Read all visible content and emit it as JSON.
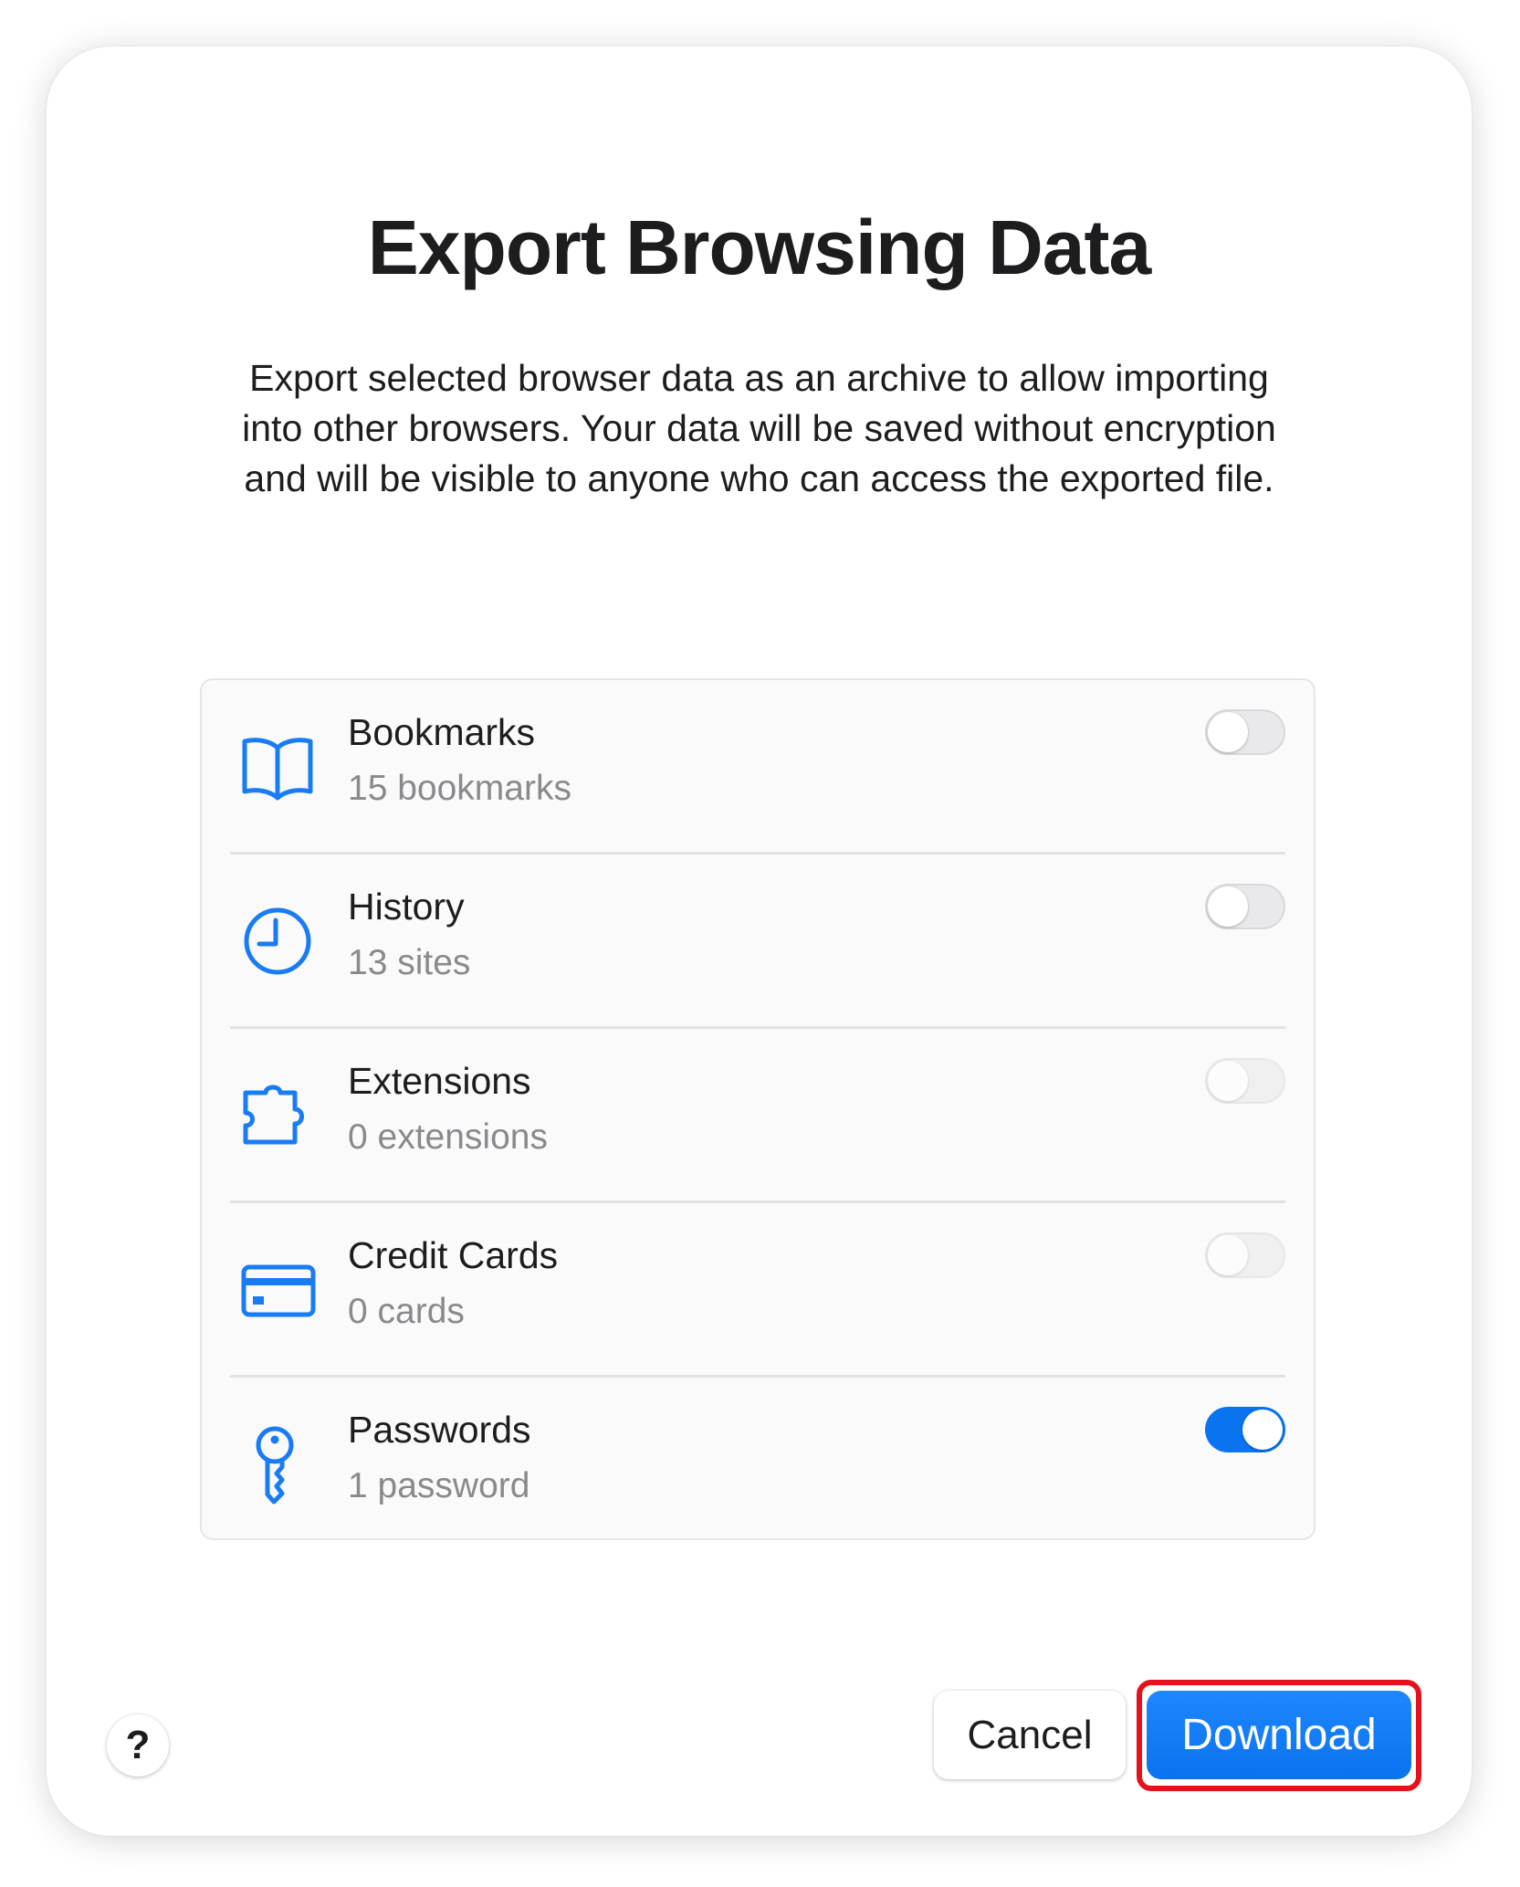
{
  "dialog": {
    "title": "Export Browsing Data",
    "description": "Export selected browser data as an archive to allow importing into other browsers. Your data will be saved without encryption and will be visible to anyone who can access the exported file."
  },
  "items": [
    {
      "label": "Bookmarks",
      "detail": "15 bookmarks",
      "icon": "book-icon",
      "enabled": false
    },
    {
      "label": "History",
      "detail": "13 sites",
      "icon": "clock-icon",
      "enabled": false
    },
    {
      "label": "Extensions",
      "detail": "0 extensions",
      "icon": "puzzle-icon",
      "enabled": false
    },
    {
      "label": "Credit Cards",
      "detail": "0 cards",
      "icon": "credit-card-icon",
      "enabled": false
    },
    {
      "label": "Passwords",
      "detail": "1 password",
      "icon": "key-icon",
      "enabled": true
    }
  ],
  "footer": {
    "help_label": "?",
    "cancel_label": "Cancel",
    "download_label": "Download"
  },
  "colors": {
    "accent": "#0a74f0",
    "icon": "#1a7cf5",
    "highlight": "#e5121b"
  }
}
